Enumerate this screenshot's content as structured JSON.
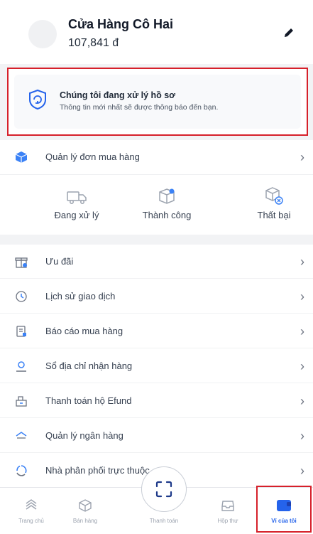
{
  "header": {
    "store_name": "Cửa Hàng Cô Hai",
    "balance": "107,841 đ"
  },
  "status_notice": {
    "title": "Chúng tôi đang xử lý hồ sơ",
    "subtitle": "Thông tin mới nhất sẽ được thông báo đến bạn."
  },
  "orders": {
    "title": "Quản lý đơn mua hàng",
    "statuses": [
      {
        "label": "Đang xử lý",
        "icon": "truck-icon"
      },
      {
        "label": "Thành công",
        "icon": "box-check-icon"
      },
      {
        "label": "Thất bại",
        "icon": "box-fail-icon"
      }
    ]
  },
  "menu": [
    {
      "label": "Ưu đãi",
      "icon": "gift-icon"
    },
    {
      "label": "Lịch sử giao dịch",
      "icon": "clock-icon"
    },
    {
      "label": "Báo cáo mua hàng",
      "icon": "report-icon"
    },
    {
      "label": "Sổ địa chỉ nhận hàng",
      "icon": "address-icon"
    },
    {
      "label": "Thanh toán hộ Efund",
      "icon": "efund-icon"
    },
    {
      "label": "Quản lý ngân hàng",
      "icon": "bank-icon"
    },
    {
      "label": "Nhà phân phối trực thuộc",
      "icon": "distributor-icon"
    }
  ],
  "tabbar": [
    {
      "label": "Trang chủ",
      "icon": "home-icon"
    },
    {
      "label": "Bán hàng",
      "icon": "sell-icon"
    },
    {
      "label": "Thanh toán",
      "icon": "scan-icon"
    },
    {
      "label": "Hộp thư",
      "icon": "inbox-icon"
    },
    {
      "label": "Ví của tôi",
      "icon": "wallet-icon",
      "active": true
    }
  ],
  "colors": {
    "accent": "#2563eb",
    "highlight": "#d6202a",
    "icon_blue": "#3b82f6"
  }
}
